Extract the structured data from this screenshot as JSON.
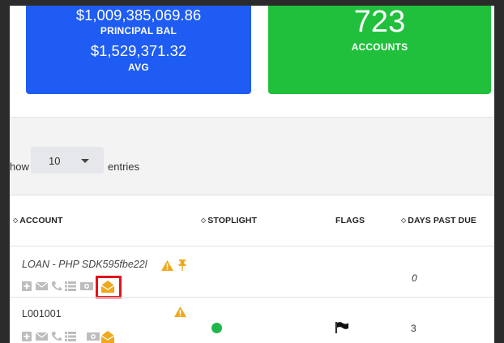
{
  "cards": {
    "blue": {
      "principal_value": "$1,009,385,069.86",
      "principal_label": "PRINCIPAL BAL",
      "avg_value": "$1,529,371.32",
      "avg_label": "AVG",
      "color": "#1e5cf3"
    },
    "green": {
      "accounts_value": "723",
      "accounts_label": "ACCOUNTS",
      "color": "#20c03c"
    }
  },
  "length_control": {
    "show_label": "how",
    "selected": "10",
    "entries_label": "entries"
  },
  "table": {
    "columns": [
      "ACCOUNT",
      "STOPLIGHT",
      "FLAGS",
      "DAYS PAST DUE"
    ],
    "rows": [
      {
        "account": "LOAN - PHP SDK595fbe22l",
        "days_past_due": "0",
        "stoplight": "",
        "flag": ""
      },
      {
        "account": "L001001",
        "days_past_due": "3",
        "stoplight": "green",
        "flag": "black-flag-icon"
      }
    ]
  },
  "icons": {
    "row_actions": [
      "plus-icon",
      "envelope-icon",
      "phone-icon",
      "list-icon",
      "money-icon",
      "open-envelope-icon"
    ],
    "warning": "warning-icon",
    "pin": "pushpin-icon"
  },
  "colors": {
    "warning": "#f0a81c",
    "action_gray": "#bdbdbd",
    "highlight": "#e0141b",
    "stoplight_green": "#22b64a"
  }
}
